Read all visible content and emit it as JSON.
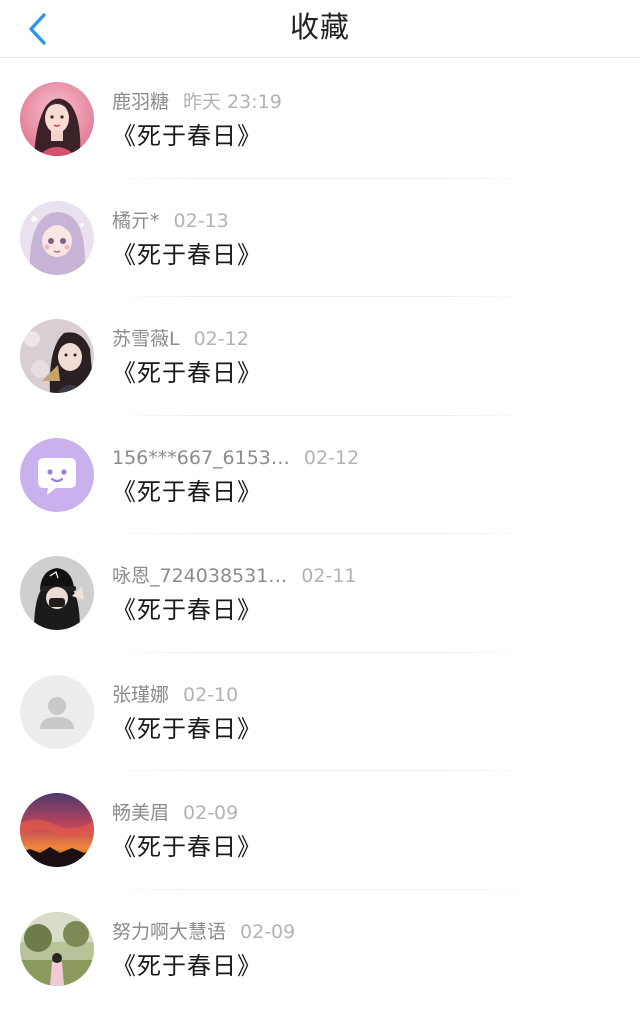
{
  "header": {
    "title": "收藏",
    "back_icon": "chevron-left-icon",
    "accent_color": "#2f95e8"
  },
  "items": [
    {
      "name": "鹿羽糖",
      "date": "昨天 23:19",
      "title": "《死于春日》",
      "avatar": "girl-portrait-pink"
    },
    {
      "name": "橘亓*",
      "date": "02-13",
      "title": "《死于春日》",
      "avatar": "anime-girl-lavender"
    },
    {
      "name": "苏雪薇L",
      "date": "02-12",
      "title": "《死于春日》",
      "avatar": "girl-with-fan"
    },
    {
      "name": "156***667_6153…",
      "date": "02-12",
      "title": "《死于春日》",
      "avatar": "chat-bubble-purple"
    },
    {
      "name": "咏恩_724038531…",
      "date": "02-11",
      "title": "《死于春日》",
      "avatar": "girl-black-cap"
    },
    {
      "name": "张瑾娜",
      "date": "02-10",
      "title": "《死于春日》",
      "avatar": "default-user-grey"
    },
    {
      "name": "畅美眉",
      "date": "02-09",
      "title": "《死于春日》",
      "avatar": "sunset-sky"
    },
    {
      "name": "努力啊大慧语",
      "date": "02-09",
      "title": "《死于春日》",
      "avatar": "garden-photo"
    }
  ]
}
